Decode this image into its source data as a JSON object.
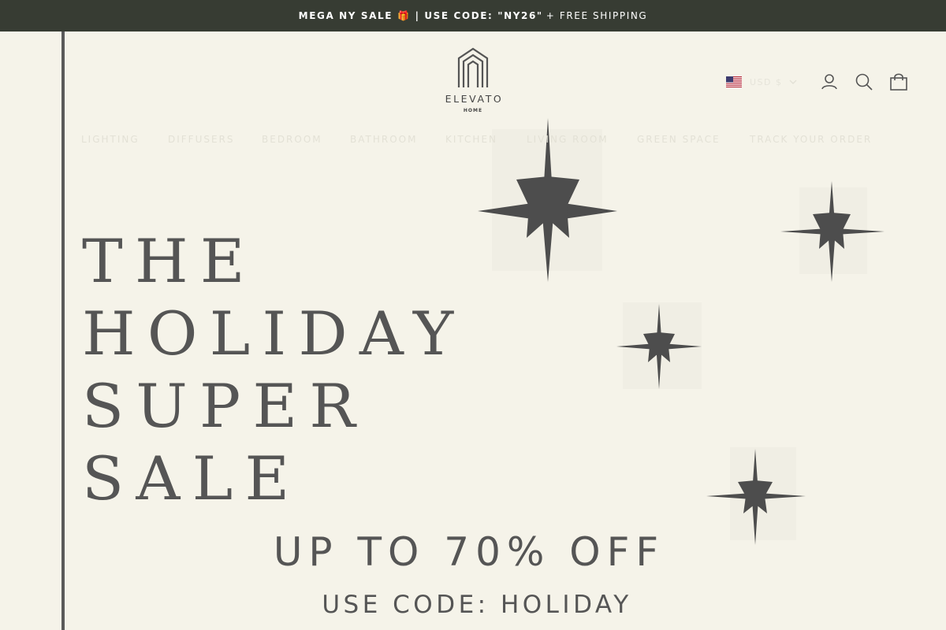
{
  "announcement": {
    "bold_text": "MEGA NY SALE",
    "gift_icon": "🎁",
    "code_text": "| USE CODE: \"NY26\"",
    "rest_text": "+ FREE SHIPPING"
  },
  "header": {
    "logo": {
      "brand": "ELEVATO",
      "sub": "HOME"
    },
    "currency": {
      "label": "USD $",
      "flag_icon": "us-flag-icon"
    },
    "icons": [
      "account-icon",
      "search-icon",
      "cart-icon"
    ]
  },
  "nav": {
    "items": [
      {
        "label": "LIGHTING"
      },
      {
        "label": "DIFFUSERS"
      },
      {
        "label": "BEDROOM"
      },
      {
        "label": "BATHROOM"
      },
      {
        "label": "KITCHEN"
      },
      {
        "label": "LIVING ROOM"
      },
      {
        "label": "GREEN SPACE"
      },
      {
        "label": "TRACK YOUR ORDER"
      }
    ]
  },
  "hero": {
    "headline": [
      "THE",
      "HOLIDAY",
      "SUPER",
      "SALE"
    ],
    "offer": "UP TO 70% OFF",
    "code": "USE CODE: HOLIDAY",
    "decoration": "sparkle-icons"
  },
  "colors": {
    "announcement_bg": "#373c33",
    "page_bg": "#f5f3e9",
    "text": "#555555",
    "sparkle": "#4a4a4a"
  }
}
